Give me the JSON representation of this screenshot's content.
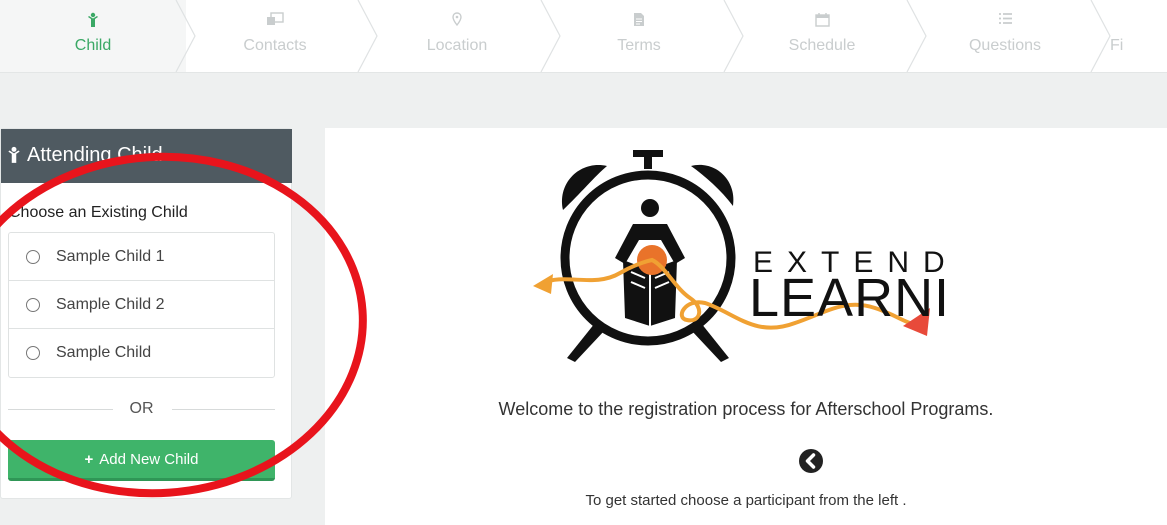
{
  "stepper": {
    "steps": [
      {
        "label": "Child",
        "icon": "child-icon",
        "active": true
      },
      {
        "label": "Contacts",
        "icon": "contacts-icon",
        "active": false
      },
      {
        "label": "Location",
        "icon": "map-pin-icon",
        "active": false
      },
      {
        "label": "Terms",
        "icon": "document-icon",
        "active": false
      },
      {
        "label": "Schedule",
        "icon": "calendar-icon",
        "active": false
      },
      {
        "label": "Questions",
        "icon": "list-icon",
        "active": false
      },
      {
        "label": "Fi",
        "icon": "",
        "active": false
      }
    ],
    "active_color": "#3aa865",
    "inactive_color": "#c9cdce"
  },
  "panel": {
    "title": "Attending Child",
    "title_icon": "child-icon",
    "choose_label": "Choose an Existing Child",
    "children": [
      {
        "name": "Sample Child 1",
        "selected": false
      },
      {
        "name": "Sample Child 2",
        "selected": false
      },
      {
        "name": "Sample Child",
        "selected": false
      }
    ],
    "or_text": "OR",
    "add_button": "Add New Child",
    "add_button_color": "#3fb46a",
    "header_color": "#4f5a61"
  },
  "main": {
    "logo": {
      "line1": "EXTENDED",
      "line2": "LEARNING"
    },
    "welcome": "Welcome to the registration process for Afterschool Programs.",
    "back_icon": "chevron-circle-left-icon",
    "instruction": "To get started choose a participant from the left ."
  },
  "annotation": {
    "shape": "ellipse",
    "color": "#e8141c"
  }
}
